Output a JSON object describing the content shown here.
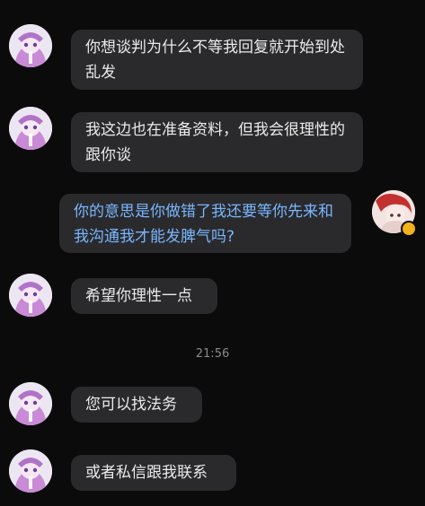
{
  "messages": [
    {
      "side": "left",
      "text": "你想谈判为什么不等我回复就开始到处乱发",
      "avatar": "anime-avatar"
    },
    {
      "side": "left",
      "text": "我这边也在准备资料，但我会很理性的跟你谈",
      "avatar": "anime-avatar"
    },
    {
      "side": "right",
      "text": "你的意思是你做错了我还要等你先来和我沟通我才能发脾气吗?",
      "avatar": "user-avatar"
    },
    {
      "side": "left",
      "text": "希望你理性一点",
      "avatar": "anime-avatar"
    },
    {
      "side": "left",
      "text": "您可以找法务",
      "avatar": "anime-avatar"
    },
    {
      "side": "left",
      "text": "或者私信跟我联系",
      "avatar": "anime-avatar"
    }
  ],
  "timestamp": "21:56",
  "colors": {
    "background": "#0b0b0c",
    "bubble": "#2a2a2c",
    "text": "#ebebeb",
    "mine_text": "#79b6ff",
    "timestamp": "#8a8a8a",
    "badge": "#f2b21b"
  }
}
